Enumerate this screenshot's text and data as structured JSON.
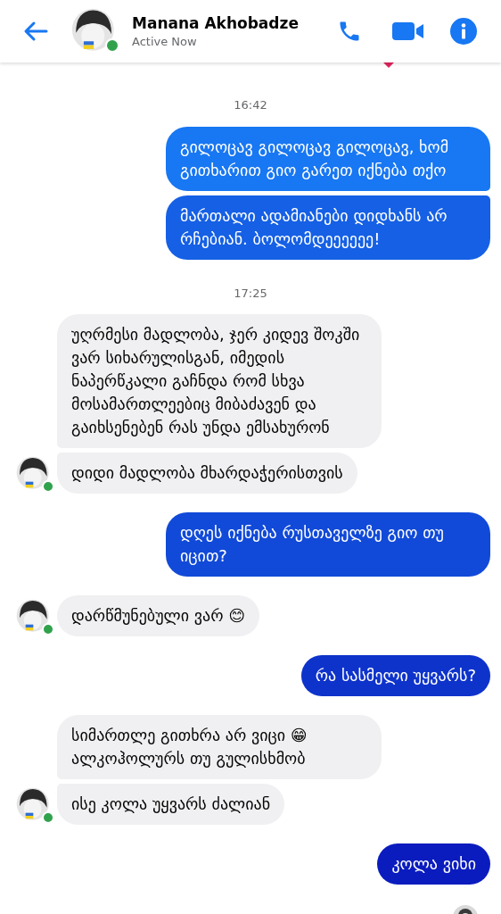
{
  "header": {
    "title": "Manana Akhobadze",
    "status": "Active Now",
    "online": true
  },
  "items": [
    {
      "kind": "time",
      "text": "16:42"
    },
    {
      "kind": "sent",
      "messages": [
        {
          "text": "გილოცავ გილოცავ გილოცავ, ხომ გითხარით გიო გარეთ იქნება თქო"
        },
        {
          "text": "მართალი ადამიანები დიდხანს არ რჩებიან. ბოლომდეეეეეე!"
        }
      ]
    },
    {
      "kind": "time",
      "text": "17:25"
    },
    {
      "kind": "received",
      "messages": [
        {
          "text": "უღრმესი მადლობა, ჯერ კიდევ შოკში ვარ სიხარულისგან, იმედის ნაპერწკალი გაჩნდა რომ სხვა მოსამართლეებიც მიბაძავენ და გაიხსენებენ რას უნდა ემსახურონ"
        },
        {
          "text": "დიდი მადლობა მხარდაჭერისთვის"
        }
      ]
    },
    {
      "kind": "sent",
      "messages": [
        {
          "text": "დღეს იქნება რუსთაველზე გიო თუ იცით?"
        }
      ]
    },
    {
      "kind": "received",
      "messages": [
        {
          "text": "დარწმუნებული ვარ 😊"
        }
      ]
    },
    {
      "kind": "sent",
      "messages": [
        {
          "text": "რა სასმელი უყვარს?"
        }
      ]
    },
    {
      "kind": "received",
      "messages": [
        {
          "text": "სიმართლე გითხრა არ ვიცი 😁 ალკოჰოლურს თუ გულისხმობ"
        },
        {
          "text": "ისე კოლა უყვარს ძალიან"
        }
      ]
    },
    {
      "kind": "sent",
      "messages": [
        {
          "text": "კოლა ვიხი"
        }
      ]
    }
  ]
}
